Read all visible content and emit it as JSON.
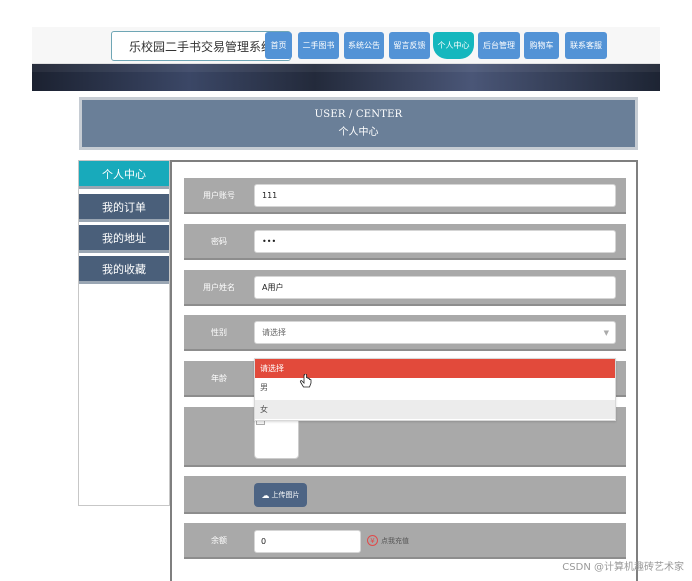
{
  "site": {
    "title": "乐校园二手书交易管理系统"
  },
  "nav": {
    "items": [
      {
        "label": "首页"
      },
      {
        "label": "二手图书"
      },
      {
        "label": "系统公告"
      },
      {
        "label": "留言反馈"
      },
      {
        "label": "个人中心",
        "active": true
      },
      {
        "label": "后台管理"
      },
      {
        "label": "购物车"
      },
      {
        "label": "联系客服"
      }
    ]
  },
  "header": {
    "title_en": "USER / CENTER",
    "title_cn": "个人中心"
  },
  "sidebar": {
    "items": [
      {
        "label": "个人中心",
        "active": true
      },
      {
        "label": "我的订单"
      },
      {
        "label": "我的地址"
      },
      {
        "label": "我的收藏"
      }
    ]
  },
  "form": {
    "account": {
      "label": "用户账号",
      "value": "111"
    },
    "password": {
      "label": "密码",
      "value": "•••"
    },
    "name": {
      "label": "用户姓名",
      "value": "A用户"
    },
    "gender": {
      "label": "性别",
      "value": "请选择",
      "options": [
        "请选择",
        "男",
        "女"
      ]
    },
    "age": {
      "label": "年龄"
    },
    "upload": {
      "label": "上传图片"
    },
    "balance": {
      "label": "余额",
      "value": "0"
    },
    "recharge": {
      "label": "点我充值"
    }
  },
  "watermark": "CSDN @计算机趣砖艺术家",
  "colors": {
    "nav": "#5393d6",
    "nav_active": "#15b7be",
    "sidebar": "#4a5f7a",
    "sidebar_active": "#18aabb",
    "header": "#6a7f98",
    "row_bg": "#a9a9a9",
    "dropdown_selected": "#e24a3b"
  }
}
